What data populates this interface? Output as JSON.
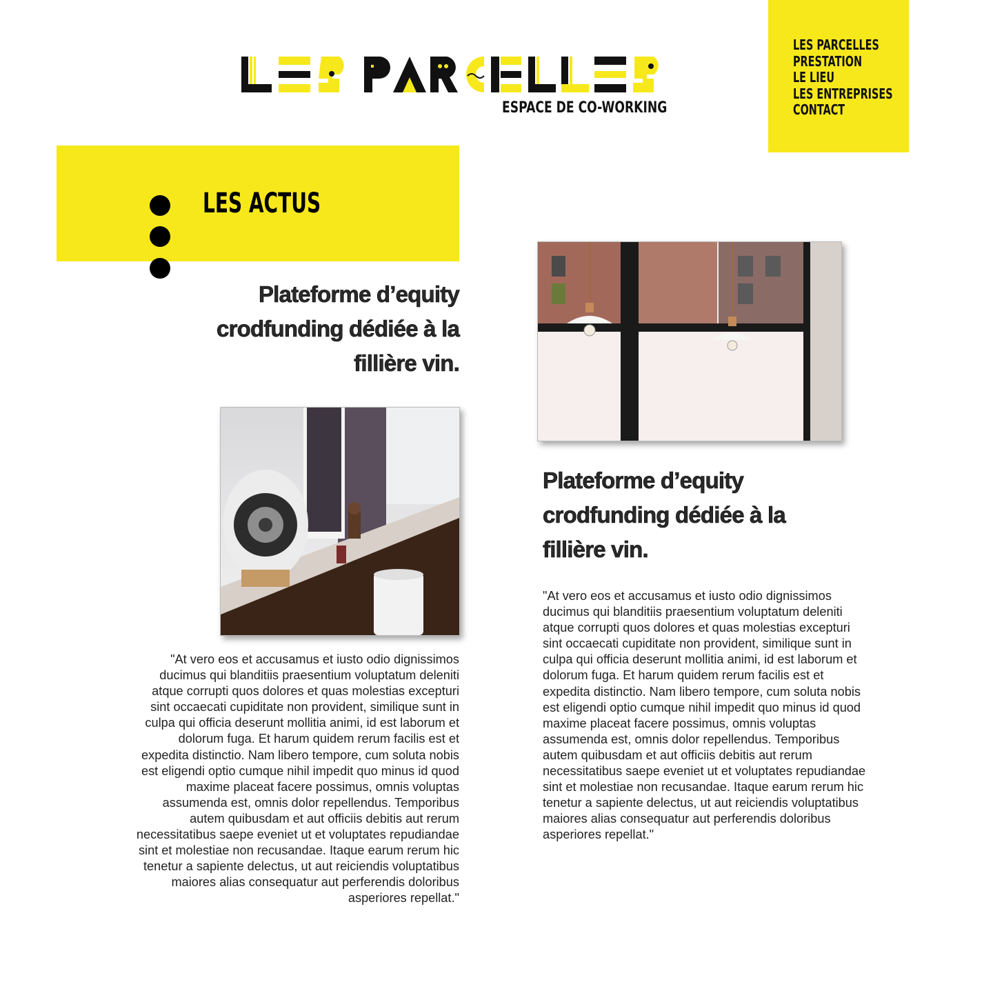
{
  "logo": {
    "wordmark": "LES PARCELLES",
    "subtitle": "ESPACE DE CO-WORKING"
  },
  "nav": {
    "items": [
      "LES PARCELLES",
      "PRESTATION",
      "LE LIEU",
      "LES ENTREPRISES",
      "CONTACT"
    ]
  },
  "section": {
    "title": "LES ACTUS"
  },
  "articles": [
    {
      "headline": "Plateforme d’equity crodfunding dédiée à la fillière vin.",
      "body": "\"At vero eos et accusamus et iusto odio dignissimos ducimus qui blanditiis praesentium voluptatum deleniti atque corrupti quos dolores et quas molestias excepturi sint occaecati cupiditate non provident, similique sunt in culpa qui officia deserunt mollitia animi, id est laborum et dolorum fuga. Et harum quidem rerum facilis est et expedita distinctio. Nam libero tempore, cum soluta nobis est eligendi optio cumque nihil impedit quo minus id quod maxime placeat facere possimus, omnis voluptas assumenda est, omnis dolor repellendus. Temporibus autem quibusdam et aut officiis debitis aut rerum necessitatibus saepe eveniet ut et voluptates repudiandae sint et molestiae non recusandae. Itaque earum rerum hic tenetur a sapiente delectus, ut aut reiciendis voluptatibus maiores alias consequatur aut perferendis doloribus asperiores repellat.\"",
      "image": "desk-speaker-photo"
    },
    {
      "headline": "Plateforme d’equity crodfunding dédiée à la fillière vin.",
      "body": "\"At vero eos et accusamus et iusto odio dignissimos ducimus qui blanditiis praesentium voluptatum deleniti atque corrupti quos dolores et quas molestias excepturi sint occaecati cupiditate non provident, similique sunt in culpa qui officia deserunt mollitia animi, id est laborum et dolorum fuga. Et harum quidem rerum facilis est et expedita distinctio. Nam libero tempore, cum soluta nobis est eligendi optio cumque nihil impedit quo minus id quod maxime placeat facere possimus, omnis voluptas assumenda est, omnis dolor repellendus. Temporibus autem quibusdam et aut officiis debitis aut rerum necessitatibus saepe eveniet ut et voluptates repudiandae sint et molestiae non recusandae. Itaque earum rerum hic tenetur a sapiente delectus, ut aut reiciendis voluptatibus maiores alias consequatur aut perferendis doloribus asperiores repellat.\"",
      "image": "window-lamps-photo"
    }
  ],
  "colors": {
    "accent": "#f7e81c",
    "text": "#111111"
  }
}
